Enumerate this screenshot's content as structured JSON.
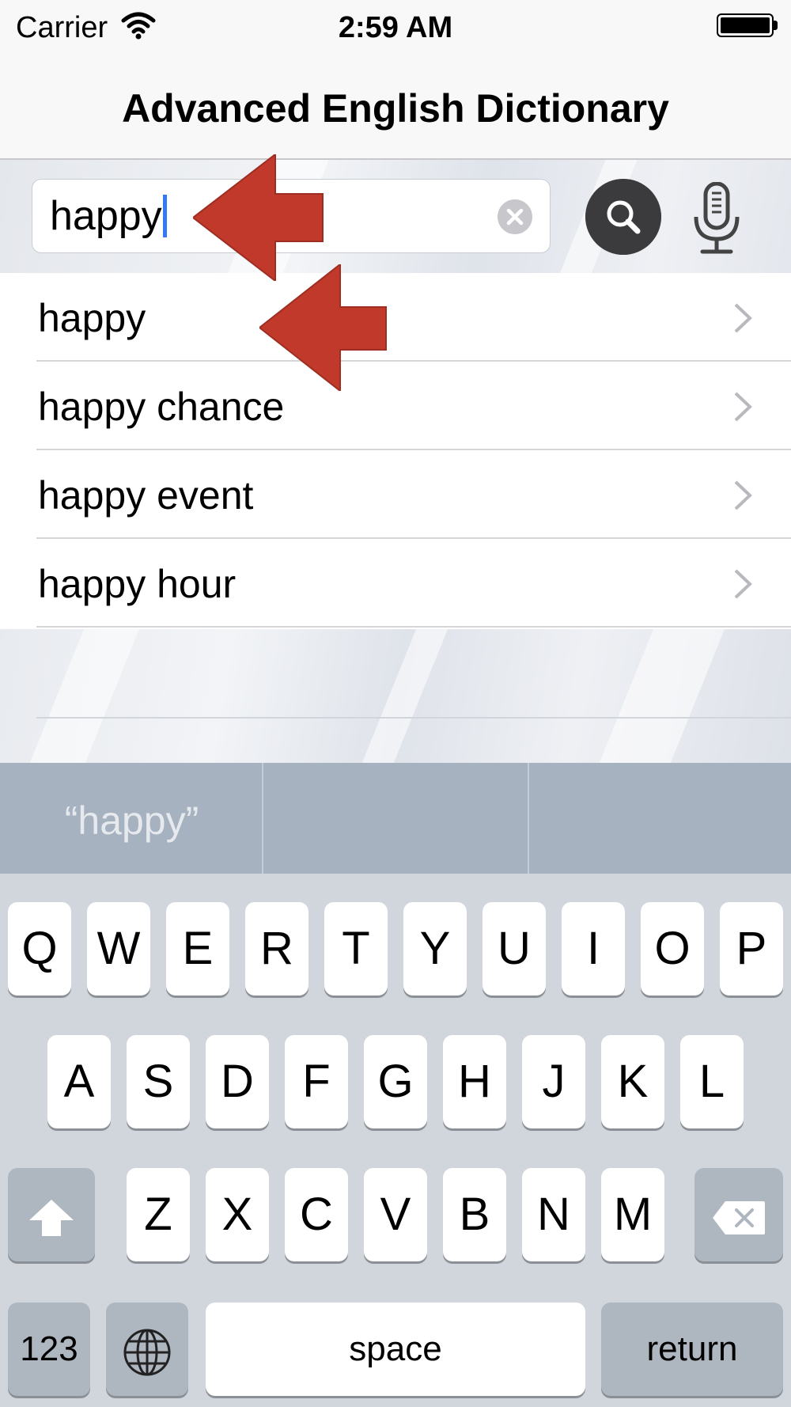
{
  "status_bar": {
    "carrier": "Carrier",
    "time": "2:59 AM"
  },
  "nav": {
    "title": "Advanced English Dictionary"
  },
  "search": {
    "value": "happy",
    "clear_icon": "clear-circle-icon",
    "search_icon": "magnifier-icon",
    "mic_icon": "microphone-icon"
  },
  "results": [
    {
      "label": "happy"
    },
    {
      "label": "happy chance"
    },
    {
      "label": "happy event"
    },
    {
      "label": "happy hour"
    }
  ],
  "annotation_color": "#c0392b",
  "keyboard": {
    "suggestions": [
      "“happy”",
      "",
      ""
    ],
    "row1": [
      "Q",
      "W",
      "E",
      "R",
      "T",
      "Y",
      "U",
      "I",
      "O",
      "P"
    ],
    "row2": [
      "A",
      "S",
      "D",
      "F",
      "G",
      "H",
      "J",
      "K",
      "L"
    ],
    "row3": [
      "Z",
      "X",
      "C",
      "V",
      "B",
      "N",
      "M"
    ],
    "numbers_label": "123",
    "space_label": "space",
    "return_label": "return",
    "shift_icon": "shift-arrow-icon",
    "delete_icon": "backspace-icon",
    "globe_icon": "globe-icon"
  }
}
